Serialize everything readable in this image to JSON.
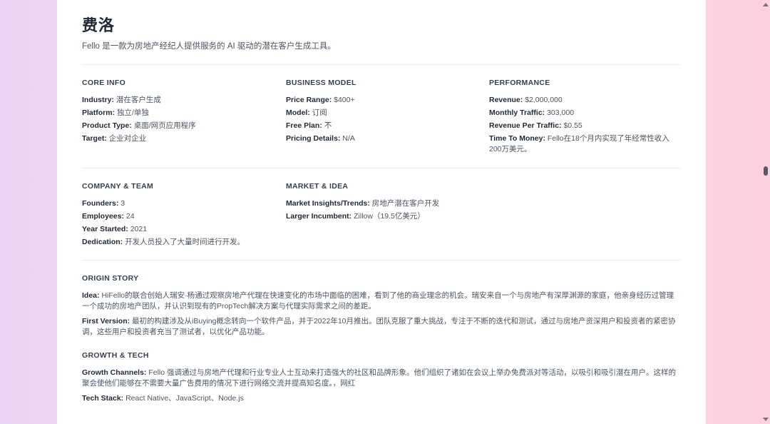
{
  "header": {
    "title": "费洛",
    "subtitle": "Fello 是一款为房地产经纪人提供服务的 AI 驱动的潜在客户生成工具。"
  },
  "core_info": {
    "heading": "CORE INFO",
    "industry_label": "Industry:",
    "industry_value": "潜在客户生成",
    "platform_label": "Platform:",
    "platform_value": "独立/单独",
    "product_type_label": "Product Type:",
    "product_type_value": "桌面/网页应用程序",
    "target_label": "Target:",
    "target_value": "企业对企业"
  },
  "business_model": {
    "heading": "BUSINESS MODEL",
    "price_range_label": "Price Range:",
    "price_range_value": "$400+",
    "model_label": "Model:",
    "model_value": "订阅",
    "free_plan_label": "Free Plan:",
    "free_plan_value": "不",
    "pricing_details_label": "Pricing Details:",
    "pricing_details_value": "N/A"
  },
  "performance": {
    "heading": "PERFORMANCE",
    "revenue_label": "Revenue:",
    "revenue_value": "$2,000,000",
    "monthly_traffic_label": "Monthly Traffic:",
    "monthly_traffic_value": "303,000",
    "rpt_label": "Revenue Per Traffic:",
    "rpt_value": "$0.55",
    "ttm_label": "Time To Money:",
    "ttm_value_line1": "Fello在18个月内实现了年经常性收入",
    "ttm_value_line2": "200万美元。"
  },
  "company_team": {
    "heading": "COMPANY & TEAM",
    "founders_label": "Founders:",
    "founders_value": "3",
    "employees_label": "Employees:",
    "employees_value": "24",
    "year_label": "Year Started:",
    "year_value": "2021",
    "dedication_label": "Dedication:",
    "dedication_value": "开发人员投入了大量时间进行开发。"
  },
  "market_idea": {
    "heading": "MARKET & IDEA",
    "insights_label": "Market Insights/Trends:",
    "insights_value": "房地产潜在客户开发",
    "incumbent_label": "Larger Incumbent:",
    "incumbent_value": "Zillow（19.5亿美元）"
  },
  "origin_story": {
    "heading": "ORIGIN STORY",
    "idea_label": "Idea:",
    "idea_value": "HiFello的联合创始人瑞安·杨通过观察房地产代理在快速变化的市场中面临的困难，看到了他的商业理念的机会。瑞安来自一个与房地产有深厚渊源的家庭，他亲身经历过管理一个成功的房地产团队，并认识到现有的PropTech解决方案与代理实际需求之间的差距。",
    "first_version_label": "First Version:",
    "first_version_value": "最初的构建涉及从iBuying概念转向一个软件产品，并于2022年10月推出。团队克服了重大挑战，专注于不断的迭代和测试，通过与房地产资深用户和投资者的紧密协调，这些用户和投资者充当了测试者，以优化产品功能。"
  },
  "growth_tech": {
    "heading": "GROWTH & TECH",
    "channels_label": "Growth Channels:",
    "channels_value": "Fello 强调通过与房地产代理和行业专业人士互动来打造强大的社区和品牌形象。他们组织了诸如在会议上举办免费派对等活动，以吸引和吸引潜在用户。这样的聚会使他们能够在不需要大量广告费用的情况下进行网络交流并提高知名度。，网红",
    "stack_label": "Tech Stack:",
    "stack_value": "React Native、JavaScript、Node.js"
  }
}
